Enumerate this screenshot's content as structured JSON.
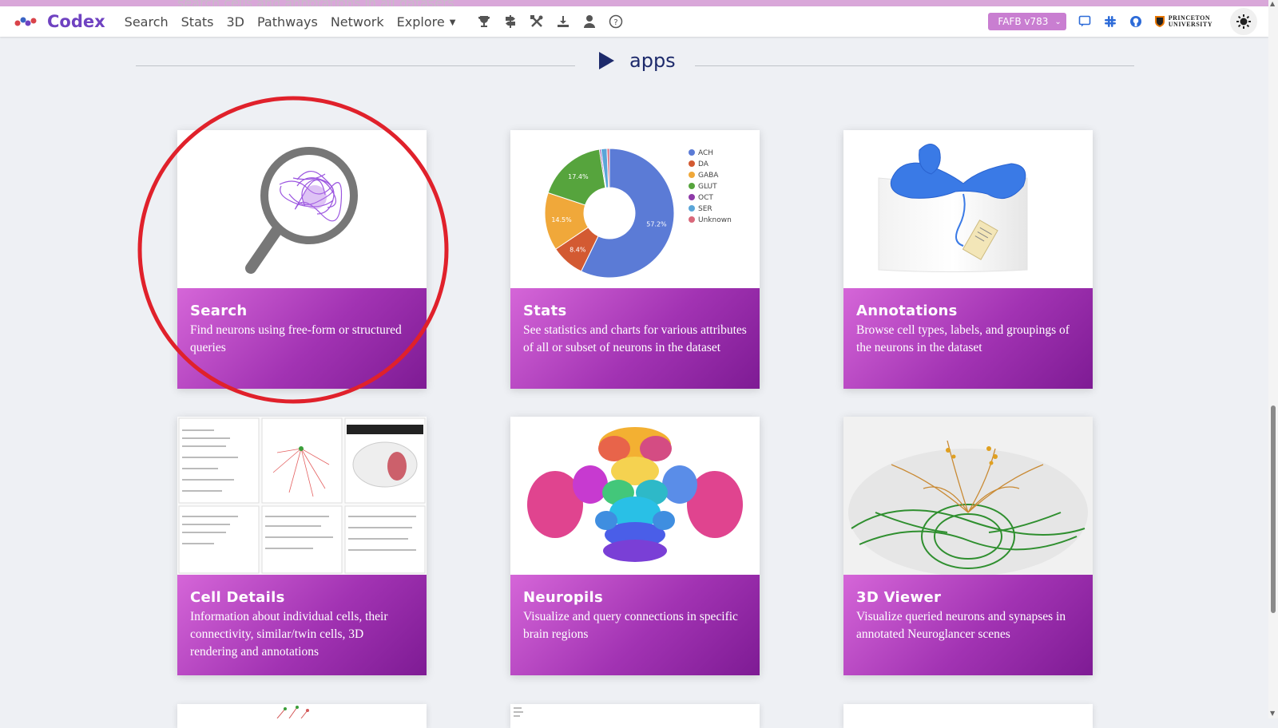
{
  "ghost_text": "search cells and annotations in all datasets",
  "navbar": {
    "brand": "Codex",
    "links": [
      "Search",
      "Stats",
      "3D",
      "Pathways",
      "Network",
      "Explore"
    ],
    "icons": [
      "trophy-icon",
      "signpost-icon",
      "tools-icon",
      "download-icon",
      "user-icon",
      "help-icon"
    ],
    "dataset": "FAFB v783",
    "right_icons": [
      "chat-icon",
      "slack-icon",
      "github-icon"
    ],
    "princeton_line1": "PRINCETON",
    "princeton_line2": "UNIVERSITY",
    "theme_icon": "sun-icon"
  },
  "section": {
    "title": "apps"
  },
  "cards": [
    {
      "title": "Search",
      "desc": "Find neurons using free-form or structured queries"
    },
    {
      "title": "Stats",
      "desc": "See statistics and charts for various attributes of all or subset of neurons in the dataset"
    },
    {
      "title": "Annotations",
      "desc": "Browse cell types, labels, and groupings of the neurons in the dataset"
    },
    {
      "title": "Cell Details",
      "desc": "Information about individual cells, their connectivity, similar/twin cells, 3D rendering and annotations"
    },
    {
      "title": "Neuropils",
      "desc": "Visualize and query connections in specific brain regions"
    },
    {
      "title": "3D Viewer",
      "desc": "Visualize queried neurons and synapses in annotated Neuroglancer scenes"
    }
  ],
  "chart_data": {
    "type": "pie",
    "categories": [
      "ACH",
      "DA",
      "GABA",
      "GLUT",
      "OCT",
      "SER",
      "Unknown"
    ],
    "values": [
      57.2,
      8.4,
      14.5,
      17.4,
      0.4,
      1.5,
      0.6
    ],
    "data_labels": [
      "57.2%",
      "8.4%",
      "14.5%",
      "17.4%",
      "",
      "",
      ""
    ],
    "colors": [
      "#5b7bd6",
      "#d35a32",
      "#f0a83a",
      "#56a43d",
      "#8e3aa8",
      "#5aa5d8",
      "#d9687a"
    ],
    "legend": "right",
    "donut": true
  },
  "colors": {
    "accent": "#6f42c1",
    "card_gradient_start": "#d566d8",
    "card_gradient_end": "#7e1b94",
    "annotation": "#e0212b"
  }
}
